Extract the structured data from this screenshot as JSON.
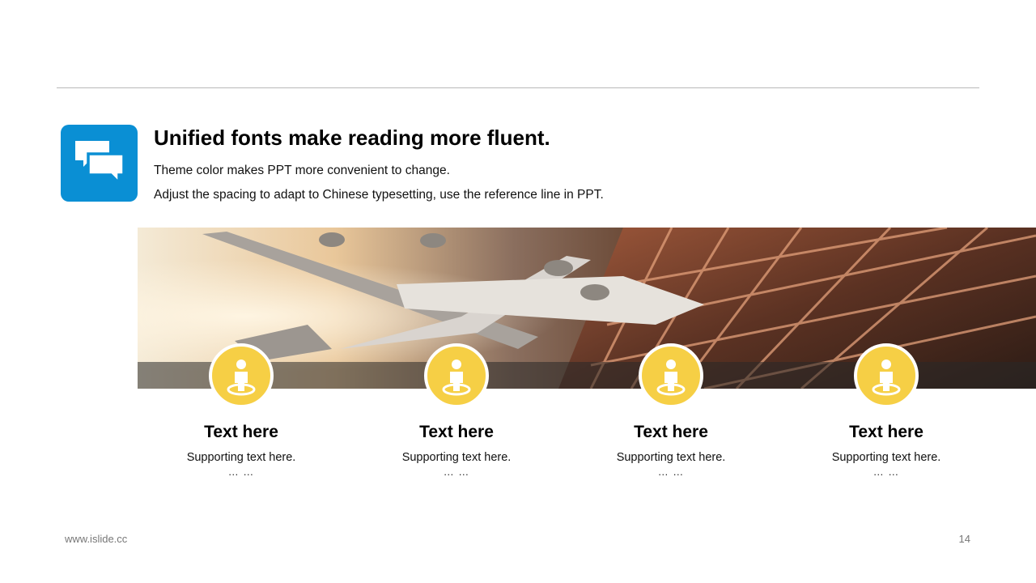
{
  "header": {
    "title": "Unified fonts make reading more fluent.",
    "line1": "Theme color makes PPT more convenient to change.",
    "line2": "Adjust the spacing to adapt to Chinese typesetting, use the reference line in PPT.",
    "badge_icon": "chat-bubbles-icon",
    "badge_color": "#0a8fd4"
  },
  "banner": {
    "image": "airplane-and-airport-photo"
  },
  "cards": [
    {
      "title": "Text here",
      "text": "Supporting text here.",
      "more": "… …",
      "icon": "person-pin-icon"
    },
    {
      "title": "Text here",
      "text": "Supporting text here.",
      "more": "… …",
      "icon": "person-pin-icon"
    },
    {
      "title": "Text here",
      "text": "Supporting text here.",
      "more": "… …",
      "icon": "person-pin-icon"
    },
    {
      "title": "Text here",
      "text": "Supporting text here.",
      "more": "… …",
      "icon": "person-pin-icon"
    }
  ],
  "accent_color": "#f6cf45",
  "footer": {
    "url": "www.islide.cc",
    "page": "14"
  }
}
